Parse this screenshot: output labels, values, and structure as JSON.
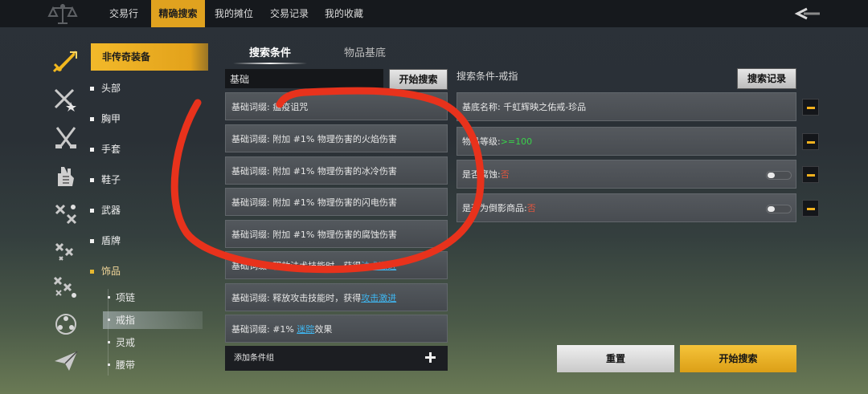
{
  "nav": {
    "tabs": [
      {
        "label": "交易行"
      },
      {
        "label": "精确搜索"
      },
      {
        "label": "我的摊位"
      },
      {
        "label": "交易记录"
      },
      {
        "label": "我的收藏"
      }
    ],
    "active_index": 1
  },
  "sidebar": {
    "header": "非传奇装备",
    "items": [
      {
        "label": "头部"
      },
      {
        "label": "胸甲"
      },
      {
        "label": "手套"
      },
      {
        "label": "鞋子"
      },
      {
        "label": "武器"
      },
      {
        "label": "盾牌"
      },
      {
        "label": "饰品"
      }
    ],
    "sub_items": [
      {
        "label": "项链"
      },
      {
        "label": "戒指"
      },
      {
        "label": "灵戒"
      },
      {
        "label": "腰带"
      }
    ],
    "active_sub_index": 1
  },
  "search": {
    "tab_conditions": "搜索条件",
    "tab_base": "物品基底",
    "input_value": "基础",
    "start_button": "开始搜索"
  },
  "results": [
    {
      "prefix": "基础词缀: ",
      "text": "瘟疫诅咒",
      "link": "",
      "suffix": ""
    },
    {
      "prefix": "基础词缀: ",
      "text": "附加 #1% 物理伤害的火焰伤害",
      "link": "",
      "suffix": ""
    },
    {
      "prefix": "基础词缀: ",
      "text": "附加 #1% 物理伤害的冰冷伤害",
      "link": "",
      "suffix": ""
    },
    {
      "prefix": "基础词缀: ",
      "text": "附加 #1% 物理伤害的闪电伤害",
      "link": "",
      "suffix": ""
    },
    {
      "prefix": "基础词缀: ",
      "text": "附加 #1% 物理伤害的腐蚀伤害",
      "link": "",
      "suffix": ""
    },
    {
      "prefix": "基础词缀: ",
      "text": "释放法术技能时，获得",
      "link": "法术激进",
      "suffix": ""
    },
    {
      "prefix": "基础词缀: ",
      "text": "释放攻击技能时，获得",
      "link": "攻击激进",
      "suffix": ""
    },
    {
      "prefix": "基础词缀: ",
      "text": "#1% ",
      "link": "迷踪",
      "suffix": "效果"
    }
  ],
  "add_group_label": "添加条件组",
  "right": {
    "title": "搜索条件-戒指",
    "record_button": "搜索记录",
    "conditions": [
      {
        "label": "基底名称: ",
        "value": "千虹辉映之佑戒-珍品",
        "value_style": "plain",
        "toggle": false
      },
      {
        "label": "物品等级:",
        "value": ">=100",
        "value_style": "green",
        "toggle": false
      },
      {
        "label": "是否腐蚀:",
        "value": "否",
        "value_style": "red",
        "toggle": true,
        "toggle_on": false
      },
      {
        "label": "是否为倒影商品:",
        "value": "否",
        "value_style": "red",
        "toggle": true,
        "toggle_on": false
      }
    ],
    "reset_button": "重置",
    "start_button": "开始搜索"
  },
  "colors": {
    "accent": "#e0a21f",
    "link": "#3fb6f0",
    "green_value": "#39d24a",
    "red_value": "#e0553e",
    "annotation": "#e8321c"
  }
}
